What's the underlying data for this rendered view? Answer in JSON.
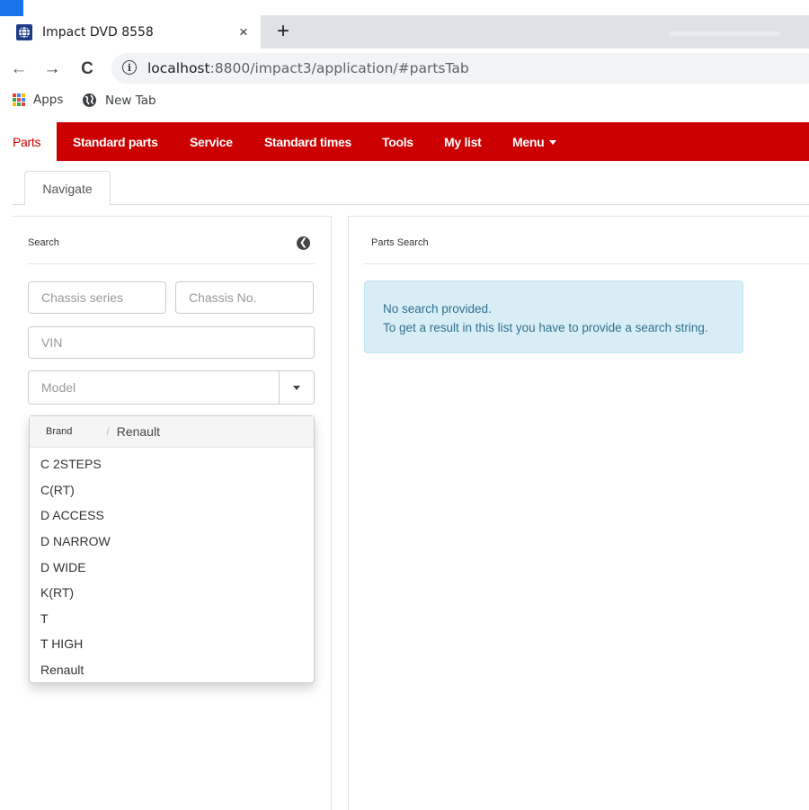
{
  "browser": {
    "tab_title": "Impact DVD 8558",
    "tab_close": "×",
    "new_tab": "+",
    "nav": {
      "back": "←",
      "forward": "→",
      "reload": "C"
    },
    "url_host": "localhost",
    "url_path": ":8800/impact3/application/#partsTab",
    "info_glyph": "i",
    "bookmarks": [
      {
        "label": "Apps"
      },
      {
        "label": "New Tab"
      }
    ]
  },
  "main_nav": {
    "items": [
      {
        "label": "Parts"
      },
      {
        "label": "Standard parts"
      },
      {
        "label": "Service"
      },
      {
        "label": "Standard times"
      },
      {
        "label": "Tools"
      },
      {
        "label": "My list"
      },
      {
        "label": "Menu"
      }
    ],
    "accent": "#cc0000"
  },
  "subtabs": [
    {
      "label": "Navigate"
    }
  ],
  "search_panel": {
    "title": "Search",
    "chassis_series_placeholder": "Chassis series",
    "chassis_no_placeholder": "Chassis No.",
    "vin_placeholder": "VIN",
    "model_placeholder": "Model",
    "dropdown": {
      "crumb_brand": "Brand",
      "crumb_separator": "/",
      "crumb_current": "Renault",
      "items": [
        "C 2STEPS",
        "C(RT)",
        "D ACCESS",
        "D NARROW",
        "D WIDE",
        "K(RT)",
        "T",
        "T HIGH",
        "Renault"
      ]
    }
  },
  "results_panel": {
    "title": "Parts Search",
    "alert_line1": "No search provided.",
    "alert_line2": "To get a result in this list you have to provide a search string."
  }
}
